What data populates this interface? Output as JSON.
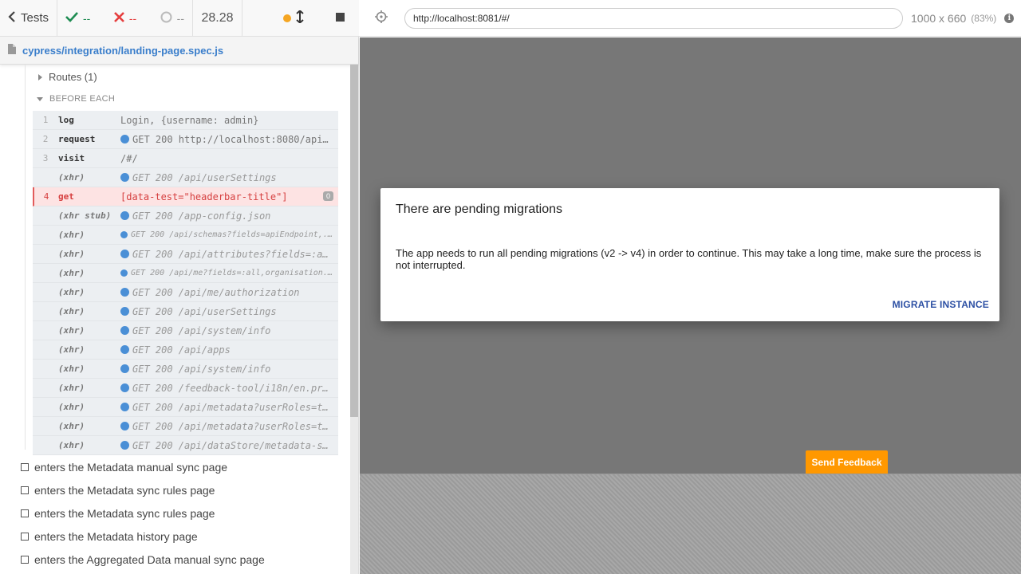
{
  "topbar": {
    "back_label": "Tests",
    "passed": "--",
    "failed": "--",
    "pending": "--",
    "duration": "28.28"
  },
  "spec": {
    "path": "cypress/integration/landing-page.spec.js"
  },
  "runnable": {
    "routes_label": "Routes (1)",
    "hook_label": "BEFORE EACH",
    "commands": [
      {
        "num": "1",
        "name": "log",
        "msg": "Login, {username: admin}"
      },
      {
        "num": "2",
        "name": "request",
        "msg": "GET 200 http://localhost:8080/api/..."
      },
      {
        "num": "3",
        "name": "visit",
        "msg": "/#/"
      },
      {
        "num": "",
        "name": "(xhr)",
        "msg": "GET 200 /api/userSettings"
      },
      {
        "num": "4",
        "name": "get",
        "msg": "[data-test=\"headerbar-title\"]",
        "badge": "0"
      },
      {
        "num": "",
        "name": "(xhr stub)",
        "msg": "GET 200 /app-config.json"
      },
      {
        "num": "",
        "name": "(xhr)",
        "msg": "GET 200 /api/schemas?fields=apiEndpoint,..."
      },
      {
        "num": "",
        "name": "(xhr)",
        "msg": "GET 200 /api/attributes?fields=:al..."
      },
      {
        "num": "",
        "name": "(xhr)",
        "msg": "GET 200 /api/me?fields=:all,organisation..."
      },
      {
        "num": "",
        "name": "(xhr)",
        "msg": "GET 200 /api/me/authorization"
      },
      {
        "num": "",
        "name": "(xhr)",
        "msg": "GET 200 /api/userSettings"
      },
      {
        "num": "",
        "name": "(xhr)",
        "msg": "GET 200 /api/system/info"
      },
      {
        "num": "",
        "name": "(xhr)",
        "msg": "GET 200 /api/apps"
      },
      {
        "num": "",
        "name": "(xhr)",
        "msg": "GET 200 /api/system/info"
      },
      {
        "num": "",
        "name": "(xhr)",
        "msg": "GET 200 /feedback-tool/i18n/en.pro..."
      },
      {
        "num": "",
        "name": "(xhr)",
        "msg": "GET 200 /api/metadata?userRoles=tr..."
      },
      {
        "num": "",
        "name": "(xhr)",
        "msg": "GET 200 /api/metadata?userRoles=tr..."
      },
      {
        "num": "",
        "name": "(xhr)",
        "msg": "GET 200 /api/dataStore/metadata-sy..."
      }
    ],
    "tests": [
      "enters the Metadata manual sync page",
      "enters the Metadata sync rules page",
      "enters the Metadata sync rules page",
      "enters the Metadata history page",
      "enters the Aggregated Data manual sync page"
    ]
  },
  "aut": {
    "url": "http://localhost:8081/#/",
    "viewport": "1000 x 660",
    "scale": "(83%)"
  },
  "dialog": {
    "title": "There are pending migrations",
    "body": "The app needs to run all pending migrations (v2 -> v4) in order to continue. This may take a long time, make sure the process is not interrupted.",
    "action": "MIGRATE INSTANCE"
  },
  "feedback_label": "Send Feedback",
  "colors": {
    "pass": "#1e8c52",
    "fail": "#e53e3e",
    "running": "#f5a623",
    "link": "#3a7ecb",
    "feedback": "#ff9800"
  }
}
